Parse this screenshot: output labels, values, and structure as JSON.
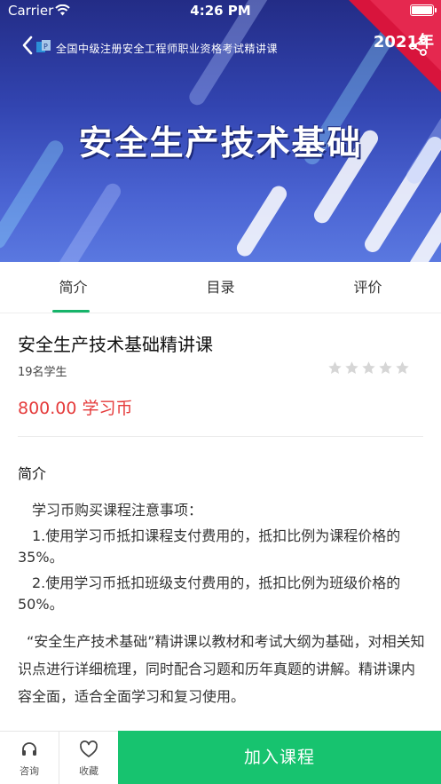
{
  "status_bar": {
    "carrier": "Carrier",
    "time": "4:26 PM"
  },
  "banner": {
    "subtitle": "全国中级注册安全工程师职业资格考试精讲课",
    "year": "2021年",
    "title": "安全生产技术基础"
  },
  "tabs": [
    {
      "label": "简介",
      "active": true
    },
    {
      "label": "目录",
      "active": false
    },
    {
      "label": "评价",
      "active": false
    }
  ],
  "course": {
    "title": "安全生产技术基础精讲课",
    "students": "19名学生",
    "rating": 0,
    "rating_max": 5,
    "price": "800.00 学习币"
  },
  "intro": {
    "heading": "简介",
    "notes_title": "学习币购买课程注意事项：",
    "note1": "1.使用学习币抵扣课程支付费用的，抵扣比例为课程价格的35%。",
    "note2": "2.使用学习币抵扣班级支付费用的，抵扣比例为班级价格的50%。",
    "description": "“安全生产技术基础”精讲课以教材和考试大纲为基础，对相关知识点进行详细梳理，同时配合习题和历年真题的讲解。精讲课内容全面，适合全面学习和复习使用。"
  },
  "bottom_bar": {
    "consult_label": "咨询",
    "favorite_label": "收藏",
    "enroll_label": "加入课程"
  },
  "colors": {
    "accent": "#17c36f",
    "price": "#e53b3b",
    "ribbon": "#d8143c"
  }
}
